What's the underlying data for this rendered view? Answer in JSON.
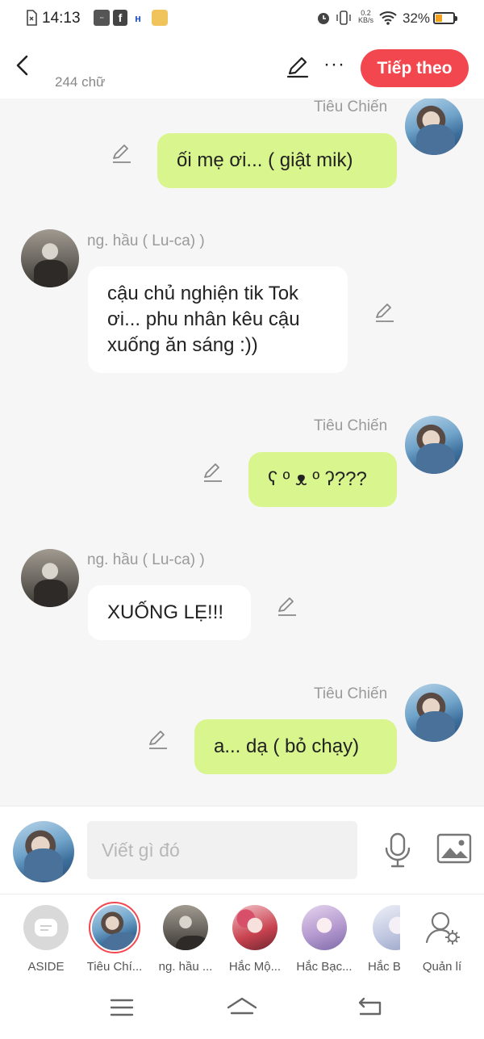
{
  "status_bar": {
    "time": "14:13",
    "network_speed_value": "0.2",
    "network_speed_unit": "KB/s",
    "battery_percent": "32%",
    "battery_level": 0.32,
    "icons": [
      "sim-icon",
      "notification-app-icon",
      "facebook-icon",
      "app-icon",
      "app-icon-2",
      "alarm-icon",
      "vibrate-icon",
      "wifi-icon",
      "battery-icon"
    ]
  },
  "header": {
    "word_count": "244 chữ",
    "next_label": "Tiếp theo"
  },
  "messages": [
    {
      "side": "right",
      "sender": "Tiêu Chiến",
      "text": "ối mẹ ơi... ( giật mik)"
    },
    {
      "side": "left",
      "sender": "ng. hầu ( Lu-ca) )",
      "text": "cậu chủ nghiện tik Tok ơi... phu nhân kêu cậu xuống ăn sáng :))"
    },
    {
      "side": "right",
      "sender": "Tiêu Chiến",
      "text": "ʕ º ᴥ º ʔ???"
    },
    {
      "side": "left",
      "sender": "ng. hầu ( Lu-ca) )",
      "text": "XUỐNG LẸ!!!"
    },
    {
      "side": "right",
      "sender": "Tiêu Chiến",
      "text": "a... dạ ( bỏ chạy)"
    }
  ],
  "composer": {
    "placeholder": "Viết gì đó"
  },
  "characters": [
    {
      "label": "ASIDE"
    },
    {
      "label": "Tiêu Chí..."
    },
    {
      "label": "ng. hầu ..."
    },
    {
      "label": "Hắc Mộ..."
    },
    {
      "label": "Hắc Bạc..."
    },
    {
      "label": "Hắc B"
    },
    {
      "label": "Quản lí"
    }
  ],
  "colors": {
    "accent": "#f2474e",
    "bubble_right": "#d9f58d",
    "bubble_left": "#ffffff",
    "chat_bg": "#f6f6f6"
  }
}
